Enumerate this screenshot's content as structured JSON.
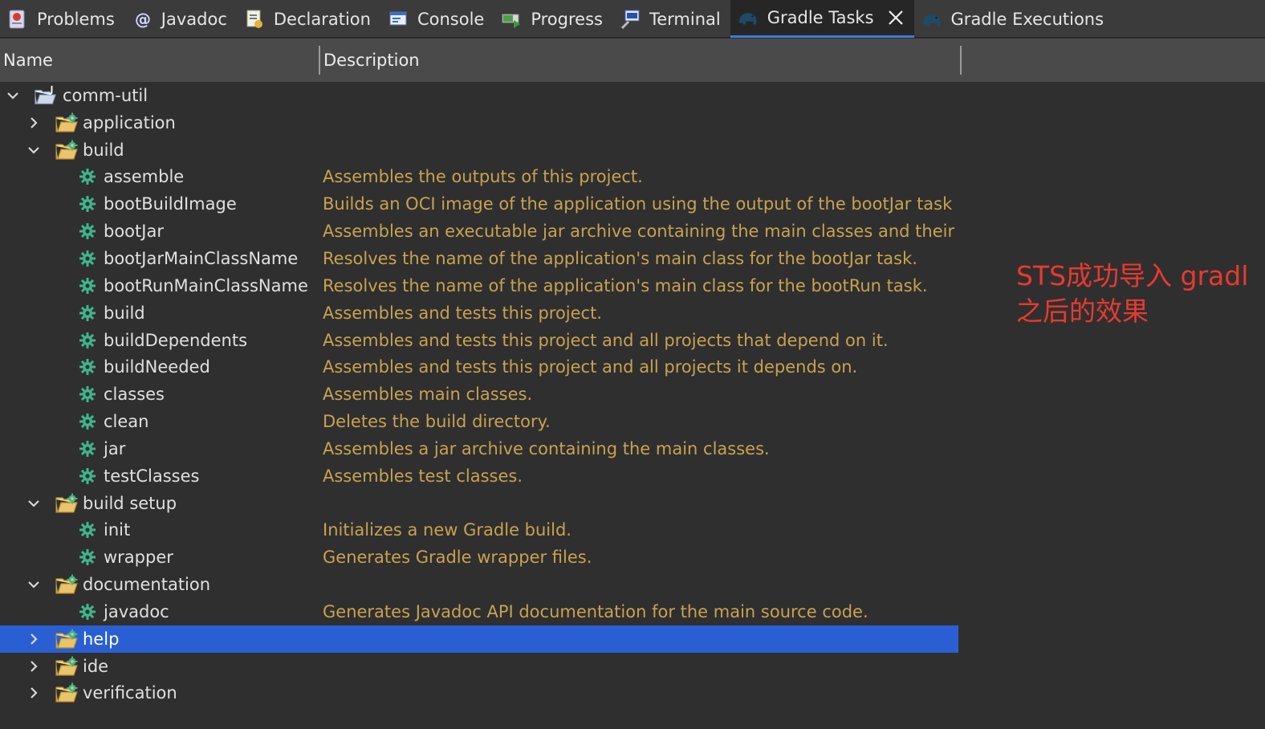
{
  "tabs": [
    {
      "label": "Problems",
      "icon": "problems-icon"
    },
    {
      "label": "Javadoc",
      "icon": "javadoc-icon"
    },
    {
      "label": "Declaration",
      "icon": "declaration-icon"
    },
    {
      "label": "Console",
      "icon": "console-icon"
    },
    {
      "label": "Progress",
      "icon": "progress-icon"
    },
    {
      "label": "Terminal",
      "icon": "terminal-icon"
    },
    {
      "label": "Gradle Tasks",
      "icon": "gradle-elephant-icon",
      "active": true
    },
    {
      "label": "Gradle Executions",
      "icon": "gradle-elephant-icon"
    }
  ],
  "columns": {
    "name": "Name",
    "description": "Description"
  },
  "tree": [
    {
      "level": 0,
      "type": "project",
      "expanded": true,
      "label": "comm-util",
      "desc": ""
    },
    {
      "level": 1,
      "type": "group",
      "expanded": false,
      "label": "application",
      "desc": ""
    },
    {
      "level": 1,
      "type": "group",
      "expanded": true,
      "label": "build",
      "desc": ""
    },
    {
      "level": 2,
      "type": "task",
      "label": "assemble",
      "desc": "Assembles the outputs of this project."
    },
    {
      "level": 2,
      "type": "task",
      "label": "bootBuildImage",
      "desc": "Builds an OCI image of the application using the output of the bootJar task"
    },
    {
      "level": 2,
      "type": "task",
      "label": "bootJar",
      "desc": "Assembles an executable jar archive containing the main classes and their d"
    },
    {
      "level": 2,
      "type": "task",
      "label": "bootJarMainClassName",
      "desc": "Resolves the name of the application's main class for the bootJar task."
    },
    {
      "level": 2,
      "type": "task",
      "label": "bootRunMainClassName",
      "desc": "Resolves the name of the application's main class for the bootRun task."
    },
    {
      "level": 2,
      "type": "task",
      "label": "build",
      "desc": "Assembles and tests this project."
    },
    {
      "level": 2,
      "type": "task",
      "label": "buildDependents",
      "desc": "Assembles and tests this project and all projects that depend on it."
    },
    {
      "level": 2,
      "type": "task",
      "label": "buildNeeded",
      "desc": "Assembles and tests this project and all projects it depends on."
    },
    {
      "level": 2,
      "type": "task",
      "label": "classes",
      "desc": "Assembles main classes."
    },
    {
      "level": 2,
      "type": "task",
      "label": "clean",
      "desc": "Deletes the build directory."
    },
    {
      "level": 2,
      "type": "task",
      "label": "jar",
      "desc": "Assembles a jar archive containing the main classes."
    },
    {
      "level": 2,
      "type": "task",
      "label": "testClasses",
      "desc": "Assembles test classes."
    },
    {
      "level": 1,
      "type": "group",
      "expanded": true,
      "label": "build setup",
      "desc": ""
    },
    {
      "level": 2,
      "type": "task",
      "label": "init",
      "desc": "Initializes a new Gradle build."
    },
    {
      "level": 2,
      "type": "task",
      "label": "wrapper",
      "desc": "Generates Gradle wrapper files."
    },
    {
      "level": 1,
      "type": "group",
      "expanded": true,
      "label": "documentation",
      "desc": ""
    },
    {
      "level": 2,
      "type": "task",
      "label": "javadoc",
      "desc": "Generates Javadoc API documentation for the main source code."
    },
    {
      "level": 1,
      "type": "group",
      "expanded": false,
      "label": "help",
      "desc": "",
      "selected": true
    },
    {
      "level": 1,
      "type": "group",
      "expanded": false,
      "label": "ide",
      "desc": ""
    },
    {
      "level": 1,
      "type": "group",
      "expanded": false,
      "label": "verification",
      "desc": ""
    }
  ],
  "annotation": {
    "line1": "STS成功导入 gradl",
    "line2": "之后的效果"
  },
  "colors": {
    "accent": "#2a5fd3",
    "description": "#c9a24f",
    "task_gear": "#3fb58e",
    "annotation": "#e83a2e"
  }
}
